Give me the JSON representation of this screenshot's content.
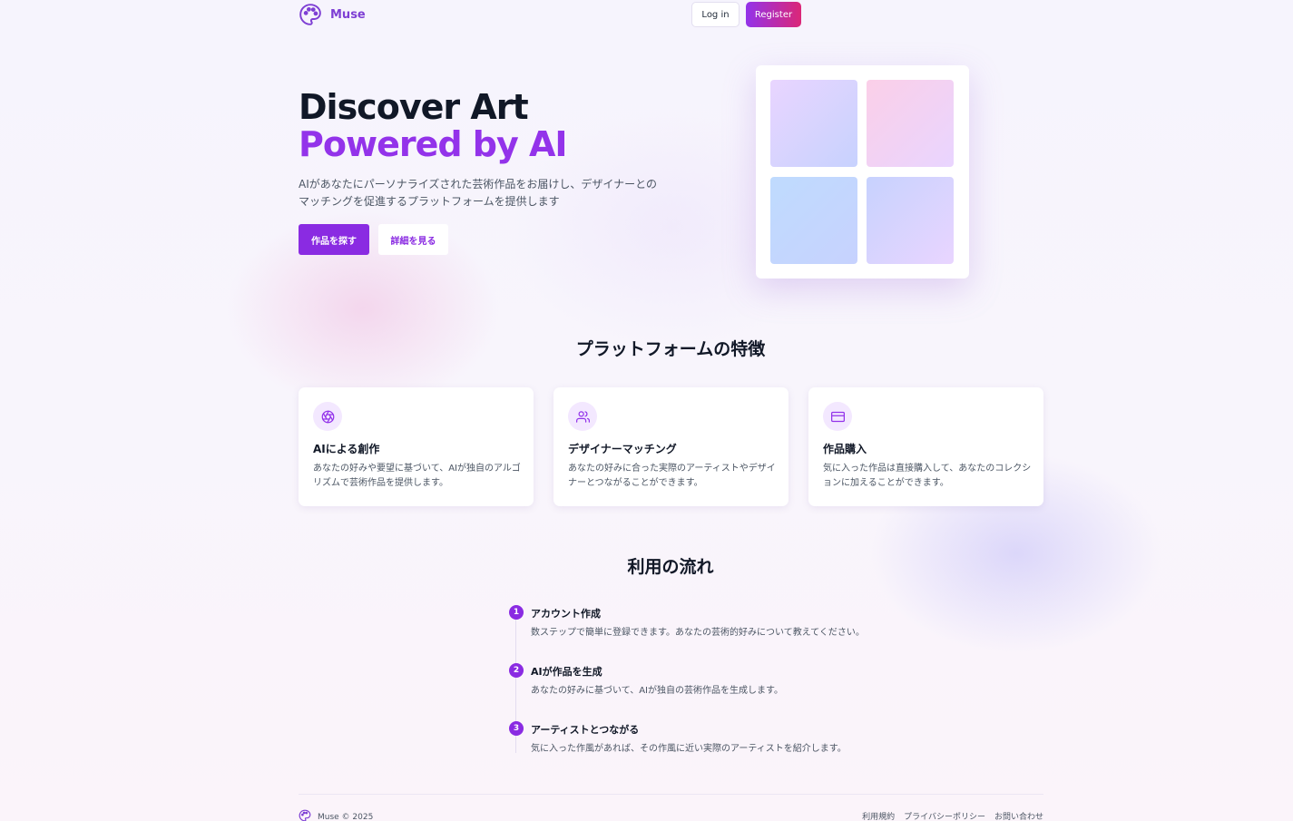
{
  "header": {
    "brand": "Muse",
    "login_label": "Log in",
    "register_label": "Register"
  },
  "hero": {
    "title_line1": "Discover Art",
    "title_line2": "Powered by AI",
    "description": "AIがあなたにパーソナライズされた芸術作品をお届けし、デザイナーとのマッチングを促進するプラットフォームを提供します",
    "primary_button": "作品を探す",
    "secondary_button": "詳細を見る"
  },
  "features": {
    "title": "プラットフォームの特徴",
    "cards": [
      {
        "icon": "aperture-icon",
        "title": "AIによる創作",
        "description": "あなたの好みや要望に基づいて、AIが独自のアルゴリズムで芸術作品を提供します。"
      },
      {
        "icon": "users-icon",
        "title": "デザイナーマッチング",
        "description": "あなたの好みに合った実際のアーティストやデザイナーとつながることができます。"
      },
      {
        "icon": "credit-card-icon",
        "title": "作品購入",
        "description": "気に入った作品は直接購入して、あなたのコレクションに加えることができます。"
      }
    ]
  },
  "flow": {
    "title": "利用の流れ",
    "steps": [
      {
        "number": "1",
        "title": "アカウント作成",
        "description": "数ステップで簡単に登録できます。あなたの芸術的好みについて教えてください。"
      },
      {
        "number": "2",
        "title": "AIが作品を生成",
        "description": "あなたの好みに基づいて、AIが独自の芸術作品を生成します。"
      },
      {
        "number": "3",
        "title": "アーティストとつながる",
        "description": "気に入った作風があれば、その作風に近い実際のアーティストを紹介します。"
      }
    ]
  },
  "footer": {
    "copyright": "Muse © 2025",
    "links": [
      "利用規約",
      "プライバシーポリシー",
      "お問い合わせ"
    ]
  },
  "colors": {
    "accent": "#8a2be2",
    "accent_light": "#9333ea",
    "brand_pink": "#db2777"
  }
}
